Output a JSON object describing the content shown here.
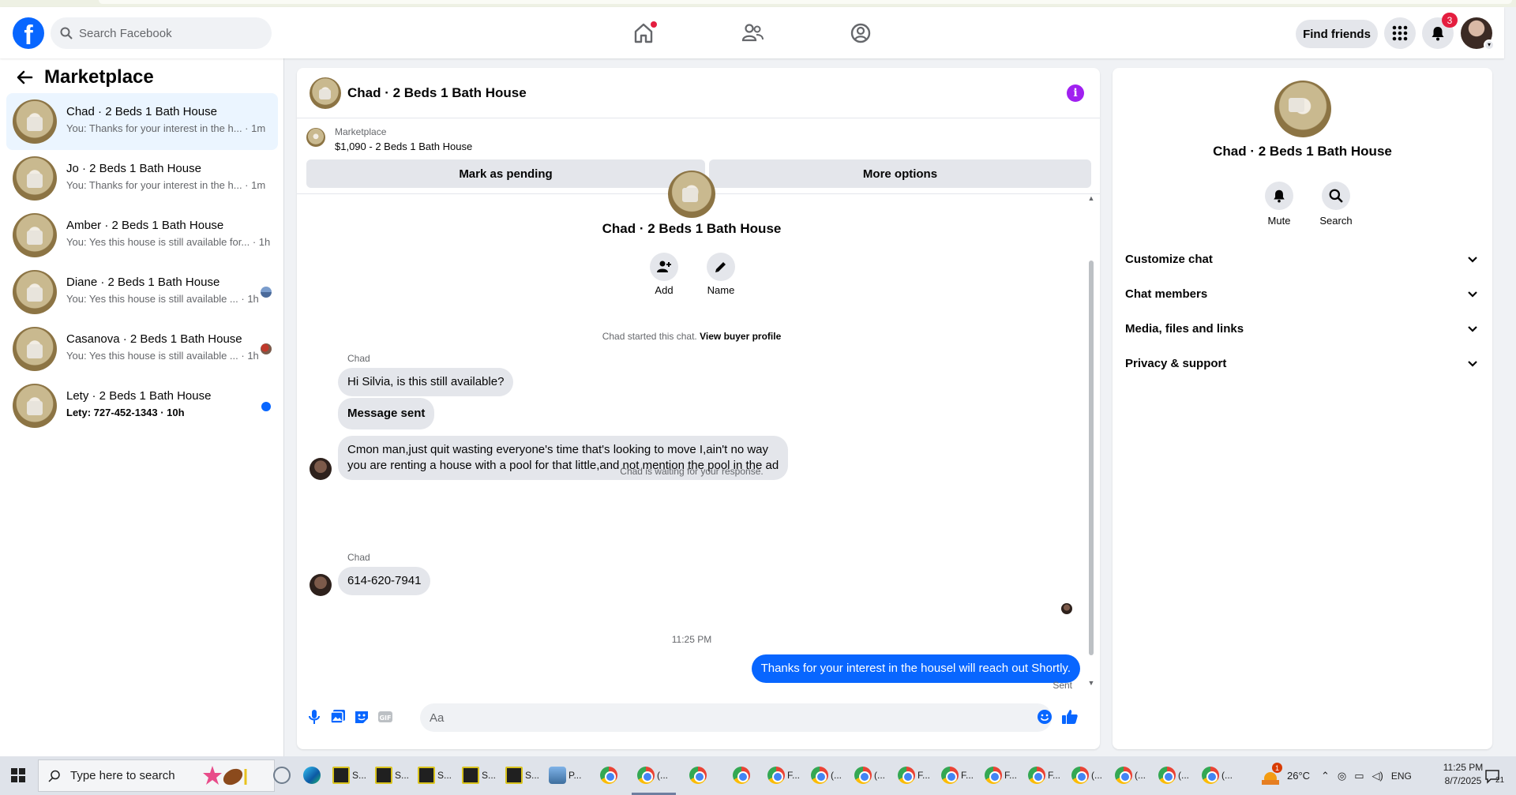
{
  "topbar": {
    "logo": "f",
    "search_placeholder": "Search Facebook",
    "find_friends": "Find friends",
    "notification_count": "3",
    "accent": "#0866ff",
    "badge_color": "#e41e3f"
  },
  "sidebar": {
    "title": "Marketplace",
    "conversations": [
      {
        "title": "Chad · 2 Beds 1 Bath House",
        "preview": "You: Thanks for your interest in the h... · 1m",
        "active": true
      },
      {
        "title": "Jo · 2 Beds 1 Bath House",
        "preview": "You: Thanks for your interest in the h... · 1m"
      },
      {
        "title": "Amber · 2 Beds 1 Bath House",
        "preview": "You: Yes this house is still available for... · 1h"
      },
      {
        "title": "Diane · 2 Beds 1 Bath House",
        "preview": "You: Yes this house is still available ... · 1h"
      },
      {
        "title": "Casanova · 2 Beds 1 Bath House",
        "preview": "You: Yes this house is still available ... · 1h"
      },
      {
        "title": "Lety · 2 Beds 1 Bath House",
        "preview": "Lety: 727-452-1343 · 10h",
        "unread": true
      }
    ]
  },
  "chat": {
    "title": "Chad · 2 Beds 1 Bath House",
    "marketplace_label": "Marketplace",
    "listing": "$1,090 - 2 Beds 1 Bath House",
    "mark_pending": "Mark as pending",
    "more_options": "More options",
    "center_title": "Chad · 2 Beds 1 Bath House",
    "actions": {
      "add": "Add",
      "name": "Name"
    },
    "started_text": "Chad started this chat.",
    "view_profile": "View buyer profile",
    "sender1": "Chad",
    "msg1": "Hi Silvia, is this still available?",
    "msg2": "Message sent",
    "msg3_line1": "Cmon man,just quit wasting everyone's time that's looking to move I,ain't no way",
    "msg3_line2": "you are renting a house with a pool for that little,and not mention the pool in the ad",
    "waiting": "Chad is waiting for your response.",
    "sender2": "Chad",
    "msg4": "614-620-7941",
    "time": "11:25 PM",
    "outgoing": "Thanks for your interest in the housel will reach out Shortly.",
    "sent_status": "Sent",
    "composer_placeholder": "Aa"
  },
  "right_panel": {
    "title": "Chad · 2 Beds 1 Bath House",
    "mute": "Mute",
    "search": "Search",
    "sections": [
      "Customize chat",
      "Chat members",
      "Media, files and links",
      "Privacy & support"
    ]
  },
  "taskbar": {
    "search_text": "Type here to search",
    "apps": [
      "S...",
      "S...",
      "S...",
      "S...",
      "S...",
      "P...",
      "(...",
      "F...",
      "(...",
      "(...",
      "F...",
      "F...",
      "F...",
      "F...",
      "(...",
      "(...",
      "(...",
      "(..."
    ],
    "temperature": "26°C",
    "language": "ENG",
    "time": "11:25 PM",
    "date": "8/7/2025",
    "notif_count": "21",
    "weather_badge": "1"
  }
}
